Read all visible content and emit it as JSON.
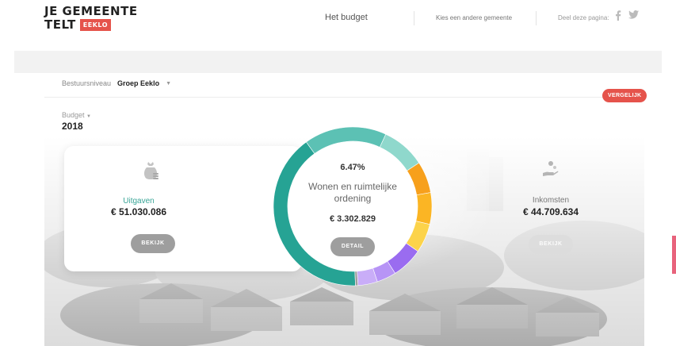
{
  "header": {
    "logo_line1": "JE GEMEENTE",
    "logo_line2": "TELT",
    "logo_badge": "EEKLO",
    "nav_budget": "Het budget",
    "nav_other_municipality": "Kies een andere gemeente",
    "nav_share": "Deel deze pagina:",
    "social": [
      "facebook-icon",
      "twitter-icon"
    ]
  },
  "level": {
    "label": "Bestuursniveau",
    "value": "Groep Eeklo"
  },
  "compare_button": "VERGELIJK",
  "budget": {
    "label": "Budget",
    "year": "2018"
  },
  "expenses": {
    "title": "Uitgaven",
    "amount": "€ 51.030.086",
    "button": "BEKIJK",
    "icon": "money-bag-icon"
  },
  "income": {
    "title": "Inkomsten",
    "amount": "€ 44.709.634",
    "button": "BEKIJK",
    "icon": "hand-coin-icon"
  },
  "selected": {
    "percentage": "6.47%",
    "name": "Wonen en ruimtelijke ordening",
    "amount": "€ 3.302.829",
    "button": "DETAIL"
  },
  "colors": {
    "accent": "#e5534b",
    "teal": "#3aa597",
    "scroll_tab": "#e8637c"
  },
  "donut_segments": [
    {
      "share": 0.41,
      "color": "#26a394"
    },
    {
      "share": 0.17,
      "color": "#5cc1b4"
    },
    {
      "share": 0.09,
      "color": "#8fd8cc"
    },
    {
      "share": 0.065,
      "color": "#f7a01c"
    },
    {
      "share": 0.065,
      "color": "#fbb524"
    },
    {
      "share": 0.06,
      "color": "#fcd34a"
    },
    {
      "share": 0.0647,
      "color": "#9a6cf0"
    },
    {
      "share": 0.04,
      "color": "#b794f6"
    },
    {
      "share": 0.04,
      "color": "#c9adf8"
    },
    {
      "share": 0.0053,
      "color": "#9e9e9e"
    }
  ],
  "scroll_indicator_icon": "scroll-position-icon"
}
